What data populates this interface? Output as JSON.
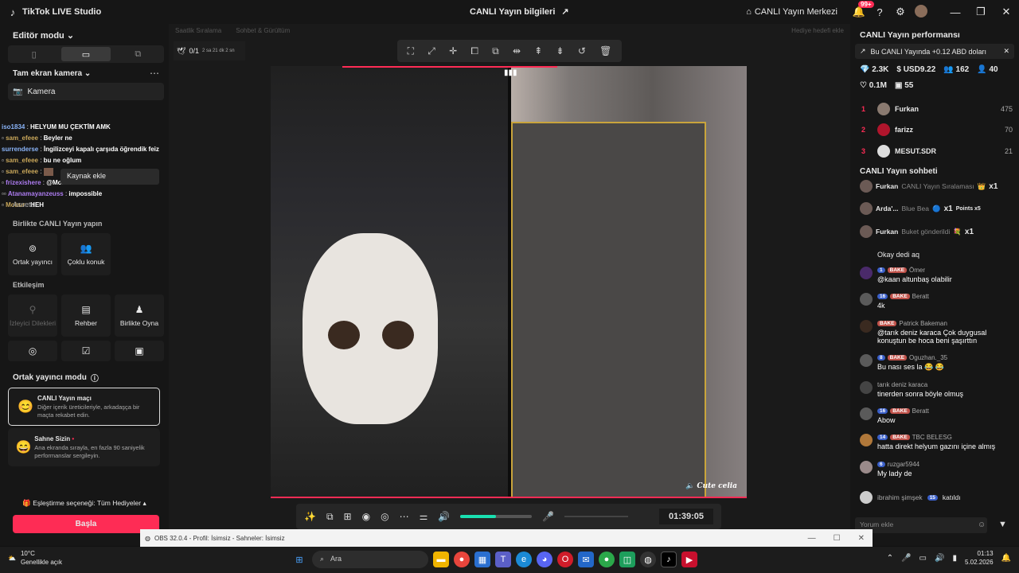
{
  "titlebar": {
    "app_name": "TikTok LIVE Studio",
    "center_title": "CANLI Yayın bilgileri",
    "home_label": "CANLI Yayın Merkezi",
    "notif_badge": "99+"
  },
  "left": {
    "editor_mode": "Editör modu",
    "camera_section": "Tam ekran kamera",
    "camera_source": "Kamera",
    "tooltip": "Kaynak ekle",
    "assets": "Assets",
    "chat_overlay": [
      {
        "user": "iso1834",
        "msg": "HELYUM MU ÇEKTİM AMK"
      },
      {
        "user": "sam_efeee",
        "msg": "Beyler ne"
      },
      {
        "user": "surrenderse",
        "msg": "İngilizceyi kapalı çarşıda öğrendik feiz"
      },
      {
        "user": "sam_efeee",
        "msg": "bu ne oğlum"
      },
      {
        "user": "sam_efeee",
        "msg": ""
      },
      {
        "user": "frizexishere",
        "msg": "@Mobur"
      },
      {
        "user": "Atanamayanzeuss",
        "msg": "impossible"
      },
      {
        "user": "Mobur",
        "msg": "HEH"
      }
    ],
    "live_together": "Birlikte CANLI Yayın yapın",
    "tiles_top": [
      {
        "label": "Ortak yayıncı",
        "icon": "link-icon"
      },
      {
        "label": "Çoklu konuk",
        "icon": "users-icon"
      }
    ],
    "interaction": "Etkileşim",
    "tiles_int": [
      {
        "label": "İzleyici Dilekleri",
        "icon": "wish-icon"
      },
      {
        "label": "Rehber",
        "icon": "guide-icon"
      },
      {
        "label": "Birlikte Oyna",
        "icon": "play-icon"
      }
    ],
    "cohost_title": "Ortak yayıncı modu",
    "match_title": "CANLI Yayın maçı",
    "match_desc": "Diğer içerik üreticileriyle, arkadaşça bir maçta rekabet edin.",
    "stage_title": "Sahne Sizin",
    "stage_desc": "Ana ekranda sırayla, en fazla 90 saniyelik performanslar sergileyin.",
    "pairing": "Eşleştirme seçeneği: Tüm Hediyeler",
    "start": "Başla"
  },
  "center": {
    "tab1": "Saatlik Sıralama",
    "tab2": "Sohbet & Gürültüm",
    "gift_goal": "Hediye hedefi ekle",
    "counter": "0/1",
    "counter_sub": "2 sa 21 dk 2 sn",
    "overlay_name": "Cute celia",
    "timer": "01:39:05",
    "volume_level": 0.5
  },
  "right": {
    "perf_title": "CANLI Yayın performansı",
    "notice": "Bu CANLI Yayında +0.12 ABD doları",
    "stats1": [
      "2.3K",
      "USD9.22",
      "162",
      "40"
    ],
    "stats2": [
      "0.1M",
      "55"
    ],
    "ranks": [
      {
        "n": "1",
        "name": "Furkan",
        "score": "475"
      },
      {
        "n": "2",
        "name": "farizz",
        "score": "70"
      },
      {
        "n": "3",
        "name": "MESUT.SDR",
        "score": "21"
      }
    ],
    "chat_title": "CANLI Yayın sohbeti",
    "events": [
      {
        "user": "Furkan",
        "text": "CANLI Yayın Sıralaması",
        "mult": "x1"
      },
      {
        "user": "Arda'...",
        "text": "Blue Bea",
        "mult": "x1",
        "extra": "Points x5"
      },
      {
        "user": "Furkan",
        "text": "Buket gönderildi",
        "mult": "x1"
      }
    ],
    "partial": "Okay dedi aq",
    "messages": [
      {
        "lv": "1",
        "bk": "BAKE",
        "user": "Ömer",
        "text": "@kaan altunbaş olabilir"
      },
      {
        "lv": "16",
        "bk": "BAKE",
        "user": "Beratt",
        "text": "4k"
      },
      {
        "lv": "",
        "bk": "BAKE",
        "user": "Patrick Bakeman",
        "text": "@tarık deniz karaca Çok duygusal konuştun be hoca beni şaşırttın"
      },
      {
        "lv": "8",
        "bk": "BAKE",
        "user": "Oguzhan._35",
        "text": "Bu nası ses la 😂 😂"
      },
      {
        "lv": "",
        "bk": "",
        "user": "tarık deniz karaca",
        "text": "tinerden sonra böyle olmuş"
      },
      {
        "lv": "16",
        "bk": "BAKE",
        "user": "Beratt",
        "text": "Abow"
      },
      {
        "lv": "14",
        "bk": "BAKE",
        "user": "TBC BELESG",
        "text": "hatta direkt helyum gazını içine almış"
      },
      {
        "lv": "6",
        "bk": "",
        "user": "ruzgar5944",
        "text": "My lady de"
      }
    ],
    "joined_user": "ibrahim şimşek",
    "joined_lv": "15",
    "joined_text": "katıldı",
    "comment_placeholder": "Yorum ekle"
  },
  "obs": {
    "title": "OBS 32.0.4 - Profil: İsimsiz - Sahneler: İsimsiz"
  },
  "taskbar": {
    "temp": "10°C",
    "weather": "Genellikle açık",
    "search": "Ara",
    "time": "01:13",
    "date": "5.02.2026"
  }
}
